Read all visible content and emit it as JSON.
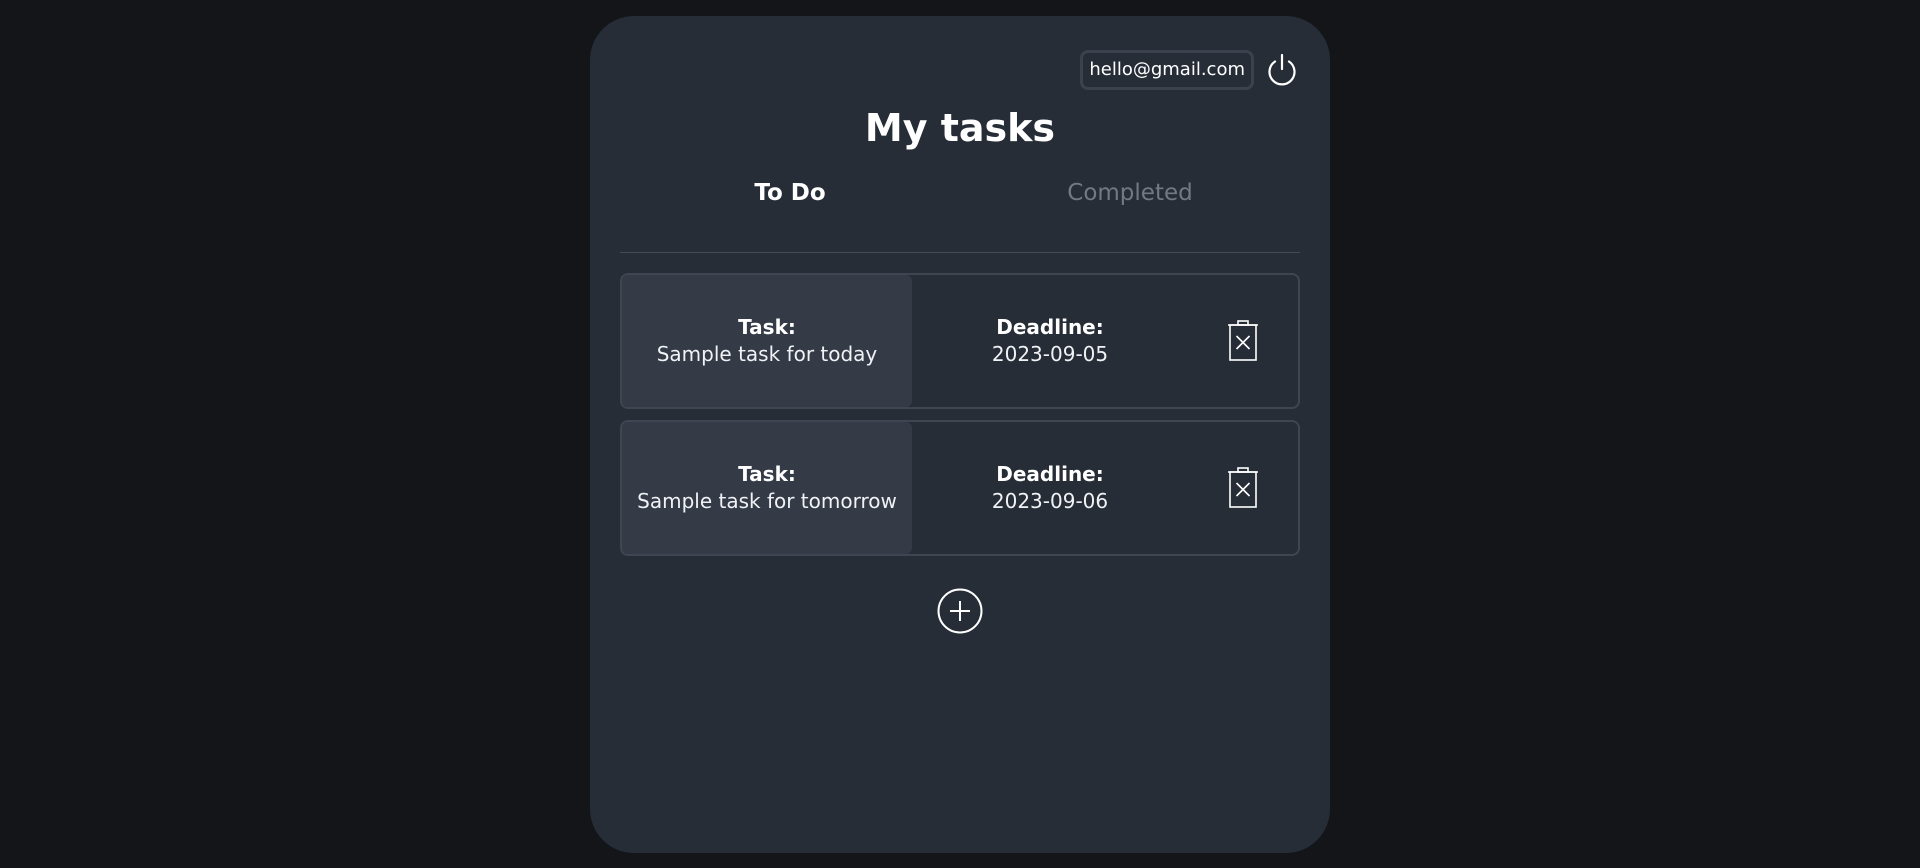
{
  "header": {
    "user_email": "hello@gmail.com",
    "logout_icon": "power-icon"
  },
  "page": {
    "title": "My tasks"
  },
  "tabs": [
    {
      "label": "To Do",
      "active": true
    },
    {
      "label": "Completed",
      "active": false
    }
  ],
  "tasks": [
    {
      "task_label": "Task:",
      "task_name": "Sample task for today",
      "deadline_label": "Deadline:",
      "deadline": "2023-09-05",
      "delete_icon": "trash-icon"
    },
    {
      "task_label": "Task:",
      "task_name": "Sample task for tomorrow",
      "deadline_label": "Deadline:",
      "deadline": "2023-09-06",
      "delete_icon": "trash-icon"
    }
  ],
  "actions": {
    "add_icon": "plus-circle-icon"
  },
  "colors": {
    "background": "#131519",
    "panel": "#262d37",
    "task_cell": "#343b47",
    "inactive_tab": "#727983",
    "text": "#ffffff"
  }
}
